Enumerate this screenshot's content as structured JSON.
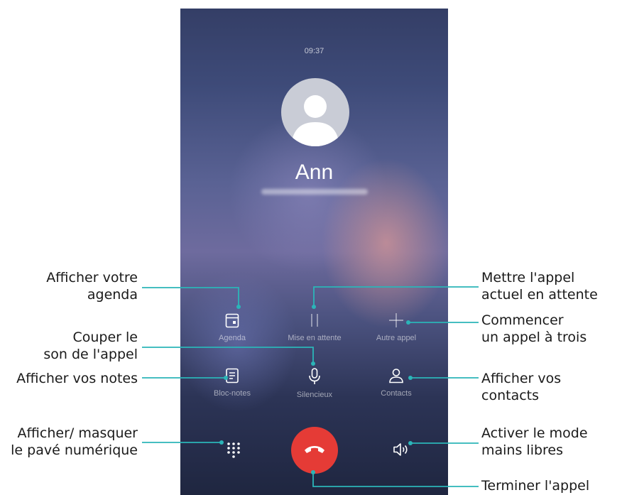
{
  "status_bar": {
    "time": "09:37"
  },
  "caller": {
    "name": "Ann"
  },
  "buttons": {
    "agenda": "Agenda",
    "hold": "Mise en attente",
    "add_call": "Autre appel",
    "notes": "Bloc-notes",
    "mute": "Silencieux",
    "contacts": "Contacts"
  },
  "annotations": {
    "agenda": "Afficher votre\nagenda",
    "mute": "Couper le\nson de l'appel",
    "notes": "Afficher vos notes",
    "keypad": "Afficher/ masquer\nle pavé numérique",
    "hold": "Mettre l'appel\nactuel en attente",
    "add_call": "Commencer\nun appel à trois",
    "contacts": "Afficher vos contacts",
    "speaker": "Activer le mode\nmains libres",
    "end_call": "Terminer l'appel"
  },
  "colors": {
    "end_call": "#e53b36",
    "callout_line": "#2bb5b8"
  },
  "icons": {
    "agenda": "calendar-icon",
    "hold": "pause-icon",
    "add_call": "plus-icon",
    "notes": "notepad-icon",
    "mute": "microphone-icon",
    "contacts": "person-icon",
    "keypad": "dialpad-icon",
    "speaker": "speaker-icon",
    "end_call": "hang-up-icon"
  }
}
